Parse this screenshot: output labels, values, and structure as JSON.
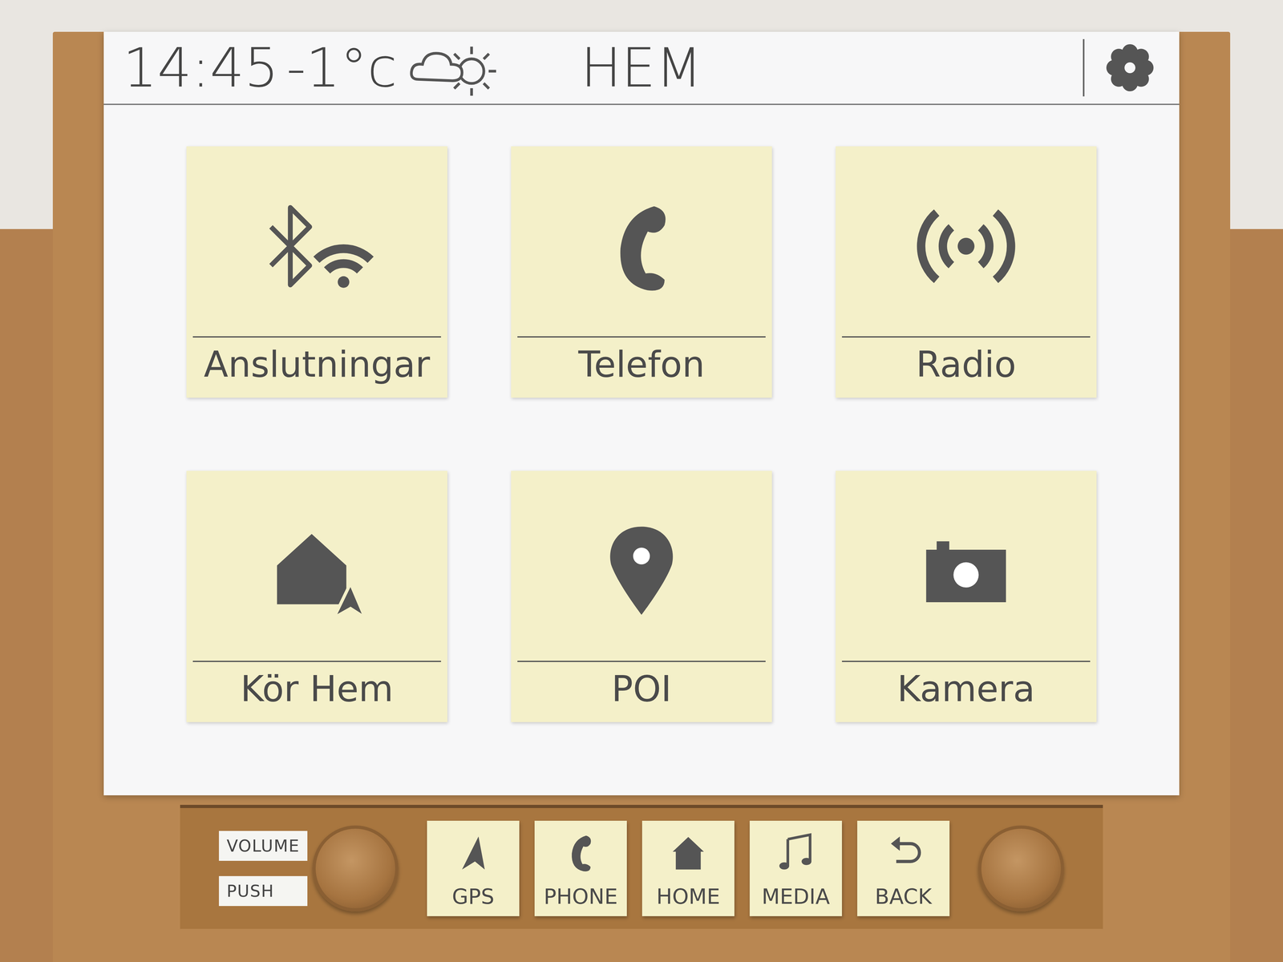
{
  "status_bar": {
    "time": "14:45",
    "temperature": "-1°c",
    "title": "HEM"
  },
  "tiles": [
    {
      "label": "Anslutningar"
    },
    {
      "label": "Telefon"
    },
    {
      "label": "Radio"
    },
    {
      "label": "Kör Hem"
    },
    {
      "label": "POI"
    },
    {
      "label": "Kamera"
    }
  ],
  "hardware": {
    "knob_labels": [
      "VOLUME",
      "PUSH"
    ],
    "buttons": [
      {
        "label": "GPS"
      },
      {
        "label": "PHONE"
      },
      {
        "label": "HOME"
      },
      {
        "label": "MEDIA"
      },
      {
        "label": "BACK"
      }
    ]
  }
}
